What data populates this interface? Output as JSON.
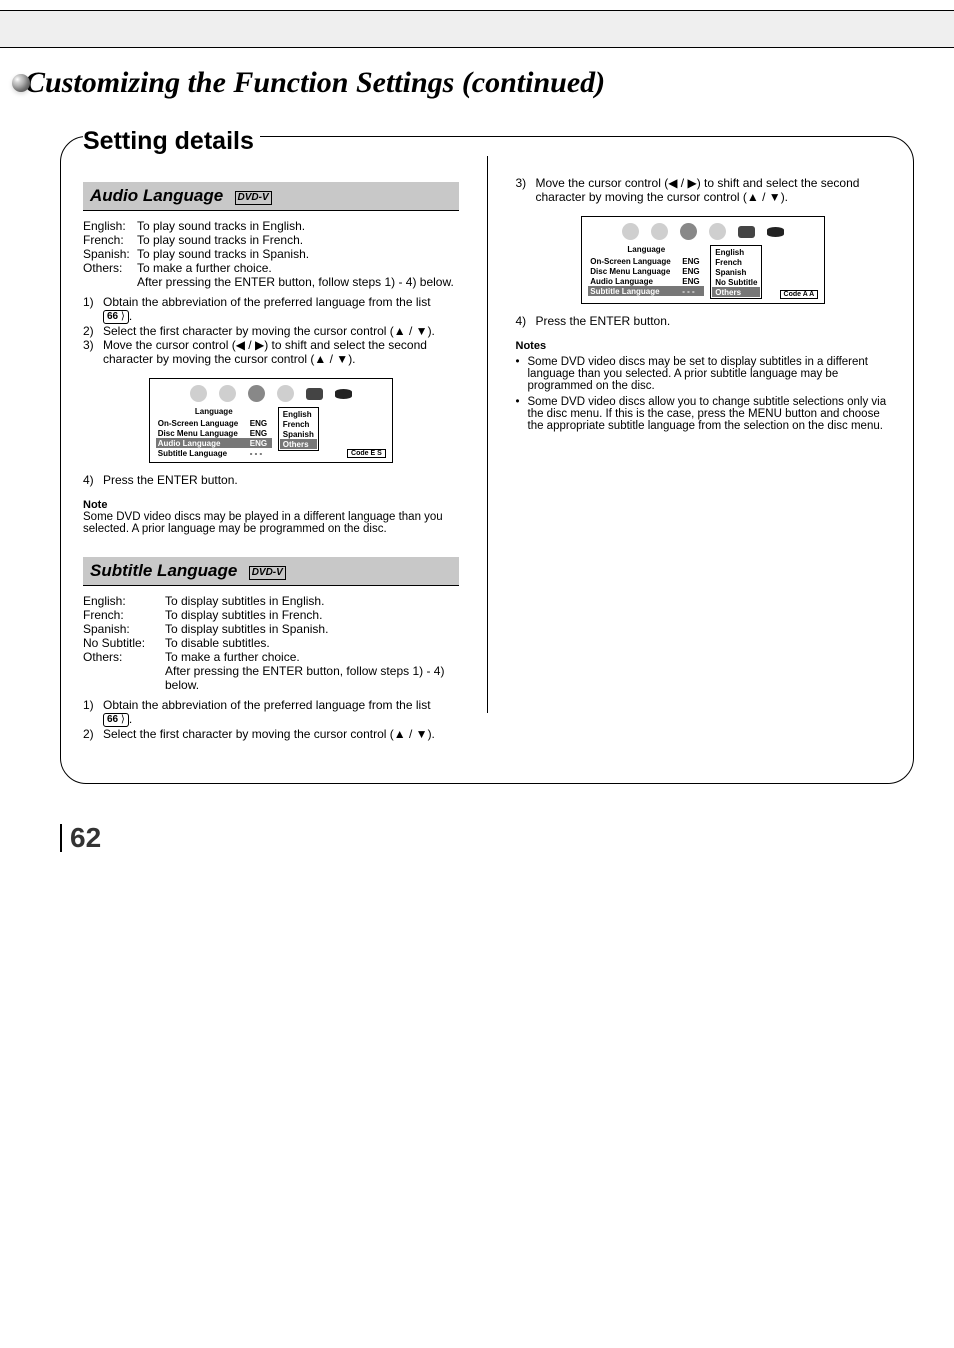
{
  "page_number": "62",
  "chapter_title": "Customizing the Function Settings (continued)",
  "panel_heading": "Setting details",
  "audio": {
    "section_title": "Audio Language",
    "options": [
      {
        "k": "English:",
        "v": "To play sound tracks in English."
      },
      {
        "k": "French:",
        "v": "To play sound tracks in French."
      },
      {
        "k": "Spanish:",
        "v": "To play sound tracks in Spanish."
      },
      {
        "k": "Others:",
        "v": "To make a further choice."
      }
    ],
    "others_sub": "After pressing the ENTER button, follow steps 1) - 4) below.",
    "steps": [
      {
        "n": "1)",
        "pre": "Obtain the abbreviation of the preferred language from the list ",
        "pg": "66",
        "post": "."
      },
      {
        "n": "2)",
        "pre": "Select the first character by moving the cursor control (",
        "arrows": "▲ / ▼",
        "post": ")."
      },
      {
        "n": "3)",
        "pre": "Move the cursor control (",
        "arrows": "◀ / ▶",
        "post": ") to shift and select the second character by moving the cursor control (",
        "arrows2": "▲ / ▼",
        "post2": ")."
      }
    ],
    "step4": "Press the ENTER button.",
    "note_h": "Note",
    "note_body": "Some DVD video discs may be played in a different language than you selected. A prior language may be programmed on the disc."
  },
  "subtitle": {
    "section_title": "Subtitle Language",
    "options": [
      {
        "k": "English:",
        "v": "To display subtitles in English."
      },
      {
        "k": "French:",
        "v": "To display subtitles in French."
      },
      {
        "k": "Spanish:",
        "v": "To display subtitles in Spanish."
      },
      {
        "k": "No Subtitle:",
        "v": "To disable subtitles."
      },
      {
        "k": "Others:",
        "v": "To make a further choice."
      }
    ],
    "others_sub": "After pressing the ENTER button, follow steps 1) - 4) below.",
    "steps": [
      {
        "n": "1)",
        "pre": "Obtain the abbreviation of the preferred language from the list ",
        "pg": "66",
        "post": "."
      },
      {
        "n": "2)",
        "pre": "Select the first character by moving the cursor control (",
        "arrows": "▲ / ▼",
        "post": ")."
      },
      {
        "n": "3)",
        "pre": "Move the cursor control (",
        "arrows": "◀ / ▶",
        "post": ") to shift and select the second character by moving the cursor control (",
        "arrows2": "▲ / ▼",
        "post2": ")."
      }
    ],
    "step4": "Press the ENTER button.",
    "note_h": "Notes",
    "notes": [
      "Some DVD video discs may be set to display subtitles in a different language than you selected. A prior subtitle language may be programmed on the disc.",
      "Some DVD video discs allow you to change subtitle selections only via the disc menu.  If this is the case, press the MENU button and choose the appropriate subtitle language from the selection on the disc menu."
    ]
  },
  "tag_label": "DVD-V",
  "osd_audio": {
    "header": "Language",
    "rows": [
      {
        "rk": "On-Screen Language",
        "rv": "ENG",
        "hl": false
      },
      {
        "rk": "Disc Menu Language",
        "rv": "ENG",
        "hl": false
      },
      {
        "rk": "Audio Language",
        "rv": "ENG",
        "hl": true
      },
      {
        "rk": "Subtitle Language",
        "rv": "- - -",
        "hl": false
      }
    ],
    "right": [
      {
        "t": "English",
        "hl": false
      },
      {
        "t": "French",
        "hl": false
      },
      {
        "t": "Spanish",
        "hl": false
      },
      {
        "t": "Others",
        "hl": true
      }
    ],
    "code": "Code   E  S"
  },
  "osd_subtitle": {
    "header": "Language",
    "rows": [
      {
        "rk": "On-Screen Language",
        "rv": "ENG",
        "hl": false
      },
      {
        "rk": "Disc Menu Language",
        "rv": "ENG",
        "hl": false
      },
      {
        "rk": "Audio Language",
        "rv": "ENG",
        "hl": false
      },
      {
        "rk": "Subtitle Language",
        "rv": "- - -",
        "hl": true
      }
    ],
    "right": [
      {
        "t": "English",
        "hl": false
      },
      {
        "t": "French",
        "hl": false
      },
      {
        "t": "Spanish",
        "hl": false
      },
      {
        "t": "No Subtitle",
        "hl": false
      },
      {
        "t": "Others",
        "hl": true
      }
    ],
    "code": "Code   A  A"
  }
}
